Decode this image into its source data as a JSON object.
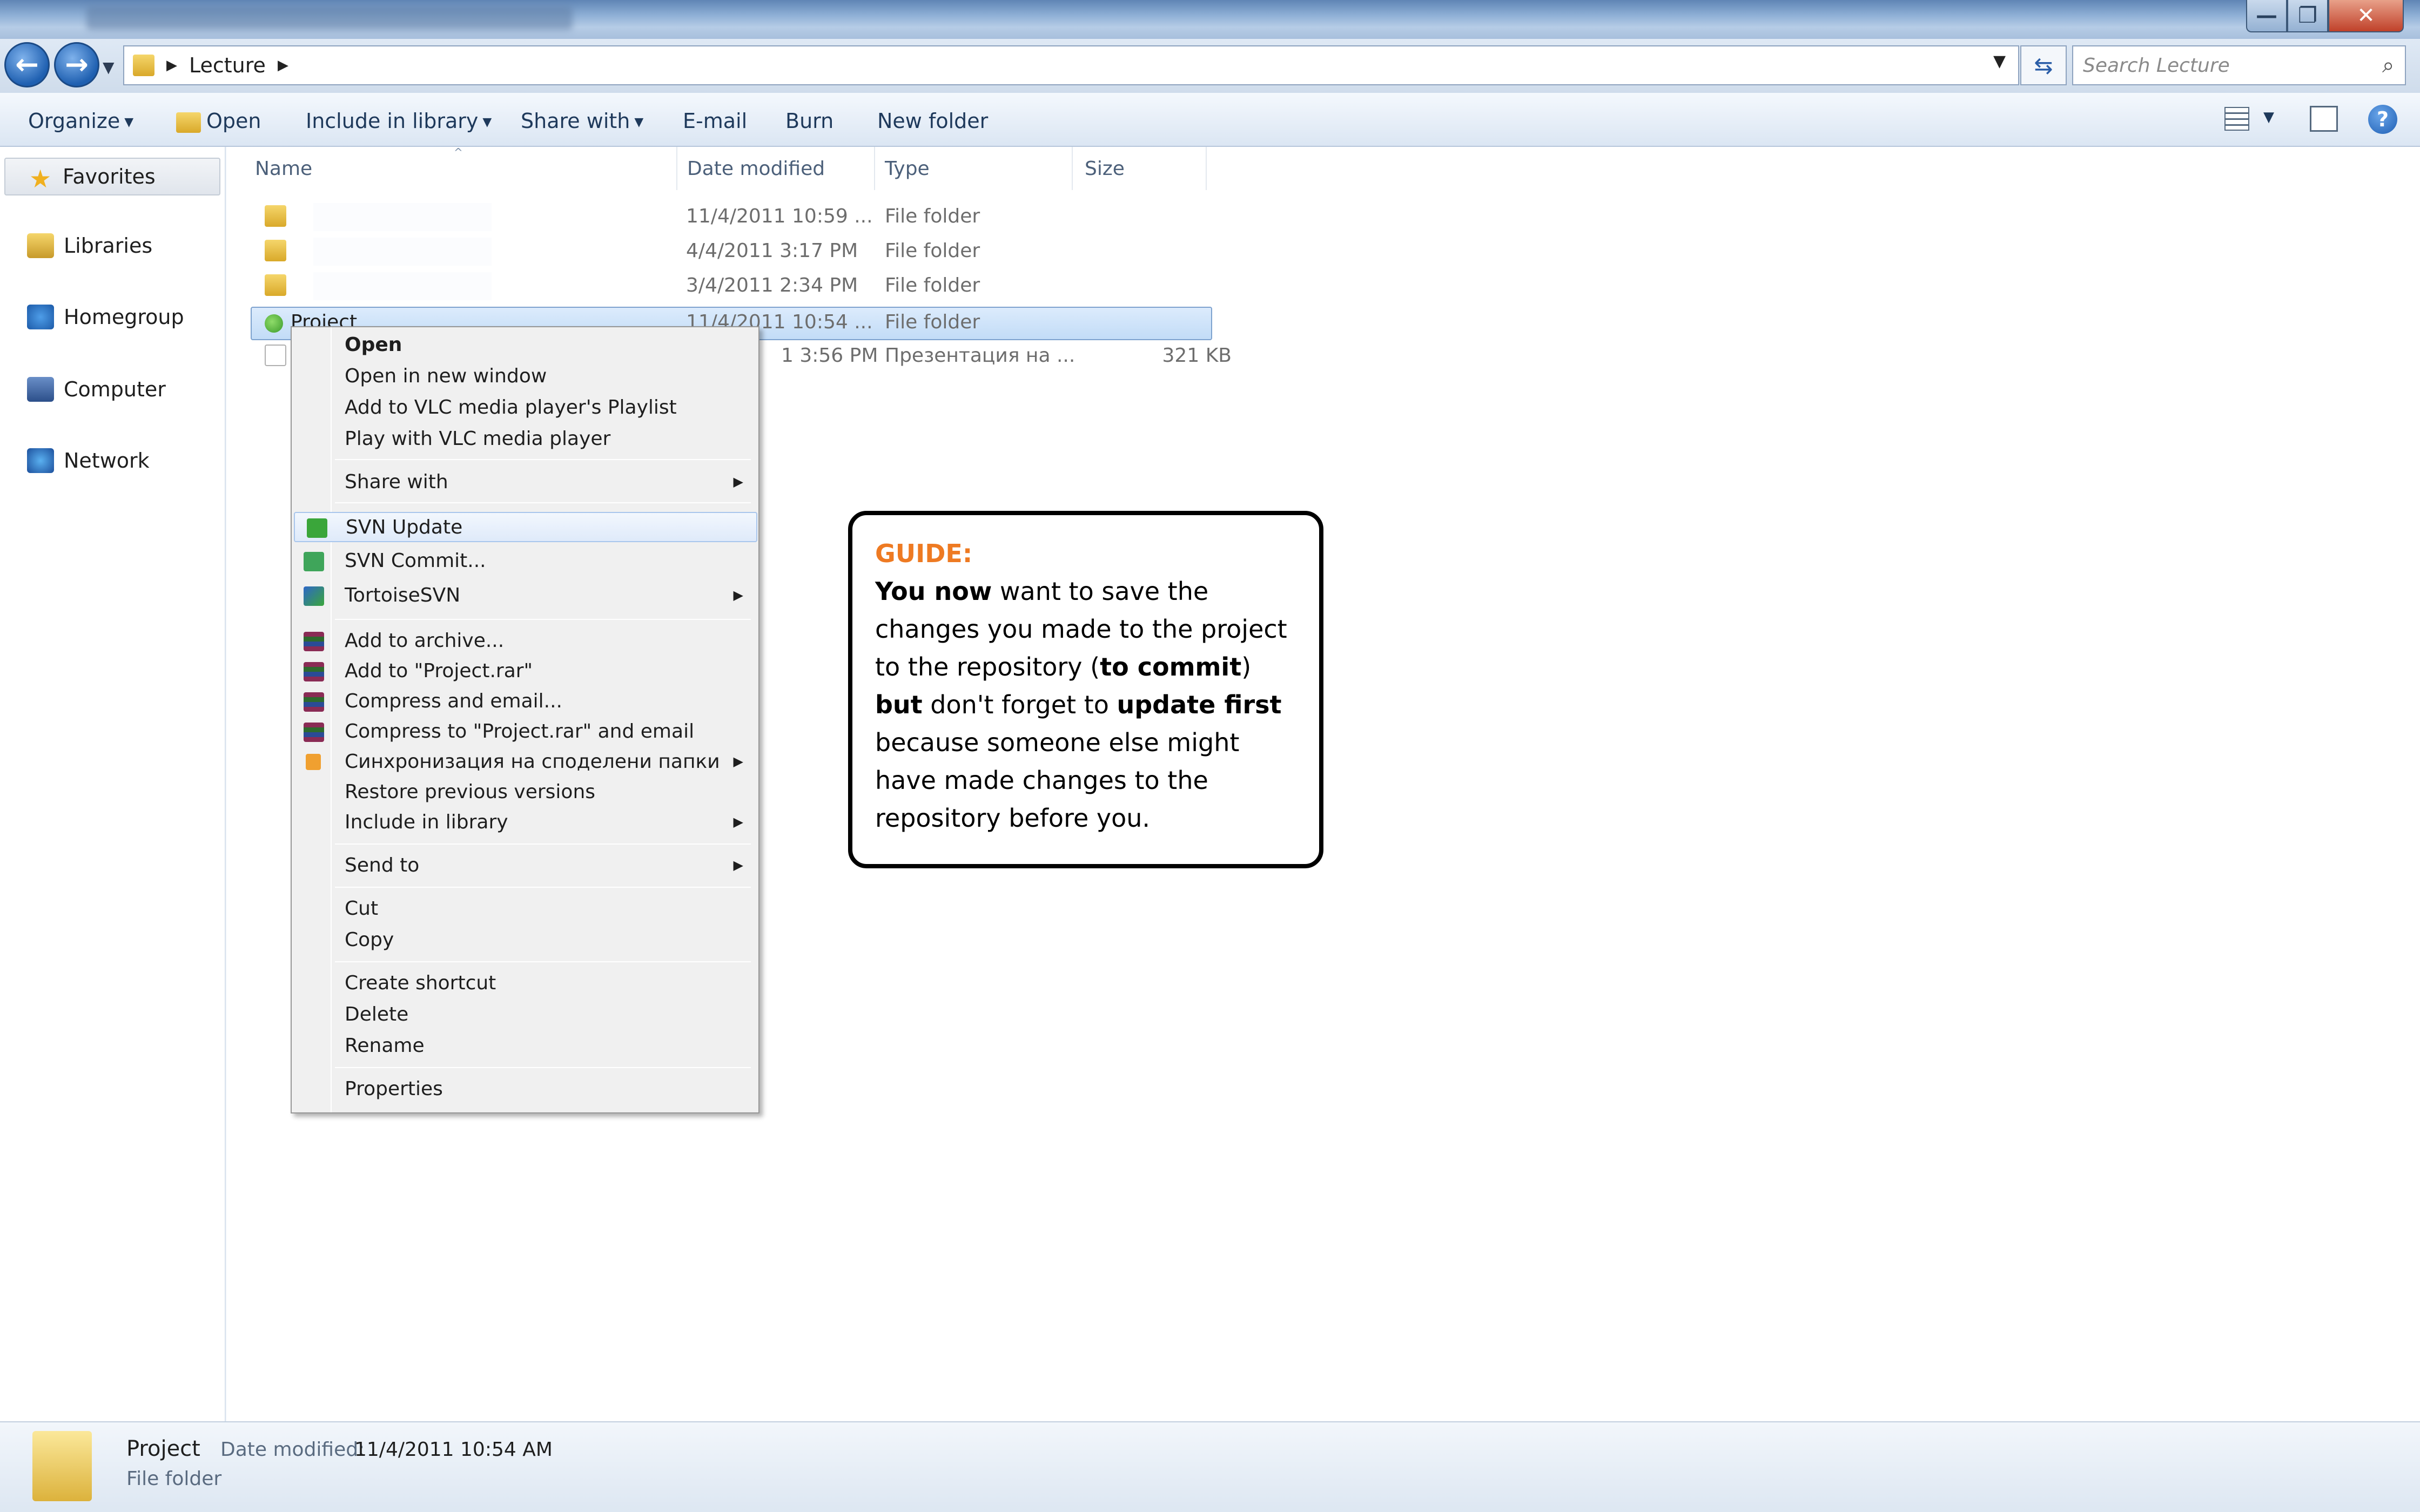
{
  "window": {
    "min_glyph": "—",
    "max_glyph": "❐",
    "close_glyph": "✕"
  },
  "address": {
    "path": [
      "Lecture"
    ],
    "search_placeholder": "Search Lecture"
  },
  "toolbar": {
    "organize": "Organize",
    "open": "Open",
    "include_in_library": "Include in library",
    "share_with": "Share with",
    "email": "E-mail",
    "burn": "Burn",
    "new_folder": "New folder"
  },
  "nav": {
    "items": [
      {
        "label": "Favorites",
        "icon": "star-icon"
      },
      {
        "label": "Libraries",
        "icon": "libraries-icon"
      },
      {
        "label": "Homegroup",
        "icon": "homegroup-icon"
      },
      {
        "label": "Computer",
        "icon": "computer-icon"
      },
      {
        "label": "Network",
        "icon": "network-icon"
      }
    ]
  },
  "columns": {
    "name": "Name",
    "date": "Date modified",
    "type": "Type",
    "size": "Size"
  },
  "files": [
    {
      "name": "",
      "date": "11/4/2011 10:59 ...",
      "type": "File folder",
      "size": ""
    },
    {
      "name": "",
      "date": "4/4/2011 3:17 PM",
      "type": "File folder",
      "size": ""
    },
    {
      "name": "",
      "date": "3/4/2011 2:34 PM",
      "type": "File folder",
      "size": ""
    },
    {
      "name": "Project",
      "date": "11/4/2011 10:54 ...",
      "type": "File folder",
      "size": ""
    },
    {
      "name": "",
      "date": "1 3:56 PM",
      "type": "Презентация на ...",
      "size": "321 KB"
    }
  ],
  "context_menu": {
    "open": "Open",
    "open_new_window": "Open in new window",
    "vlc_playlist": "Add to VLC media player's Playlist",
    "vlc_play": "Play with VLC media player",
    "share_with": "Share with",
    "svn_update": "SVN Update",
    "svn_commit": "SVN Commit...",
    "tortoise": "TortoiseSVN",
    "add_archive": "Add to archive...",
    "add_rar": "Add to \"Project.rar\"",
    "compress_email": "Compress and email...",
    "compress_rar_email": "Compress to \"Project.rar\" and email",
    "sync": "Синхронизация на споделени папки",
    "restore": "Restore previous versions",
    "include_library": "Include in library",
    "send_to": "Send to",
    "cut": "Cut",
    "copy": "Copy",
    "create_shortcut": "Create shortcut",
    "delete": "Delete",
    "rename": "Rename",
    "properties": "Properties"
  },
  "guide": {
    "title": "GUIDE:",
    "p1_bold": "You now",
    "p1": " want to save the changes you made to the project to the repository (",
    "p2_bold": "to commit",
    "p3": ") ",
    "p4_bold": "but",
    "p5": " don't forget to ",
    "p6_bold": "update first",
    "p7": " because someone else might have made changes to the repository before you."
  },
  "details": {
    "name": "Project",
    "date_label": "Date modified:",
    "date": "11/4/2011 10:54 AM",
    "type": "File folder"
  },
  "colors": {
    "guide_title": "#ee7a22",
    "selection": "#c2dcf7"
  }
}
